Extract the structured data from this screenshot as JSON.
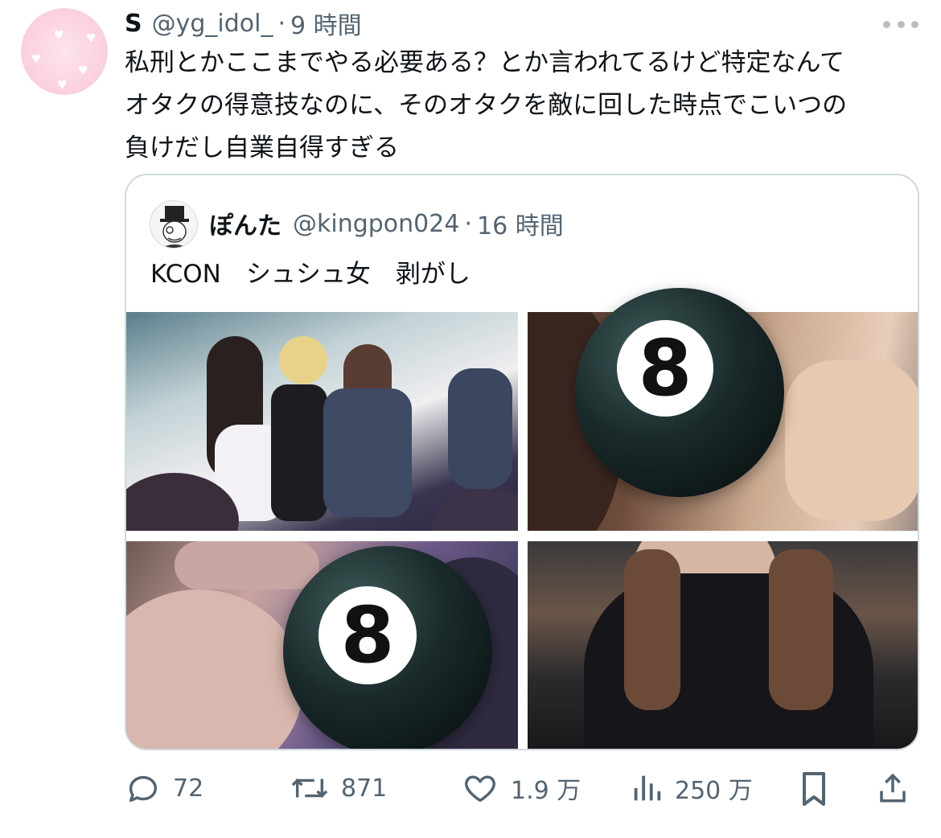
{
  "tweet": {
    "author_name": "S",
    "author_handle": "@yg_idol_",
    "separator": "·",
    "time": "9 時間",
    "text_lines": [
      "私刑とかここまでやる必要ある？とか言われてるけど特定なんて",
      "オタクの得意技なのに、そのオタクを敵に回した時点でこいつの",
      "負けだし自業自得すぎる"
    ]
  },
  "quote": {
    "author_name": "ぽんた",
    "author_handle": "@kingpon024",
    "separator": "·",
    "time": "16 時間",
    "text": "KCON　シュシュ女　剥がし",
    "media": [
      {
        "name": "stage-photo"
      },
      {
        "name": "face-photo-1",
        "overlay": "8"
      },
      {
        "name": "face-photo-2",
        "overlay": "8"
      },
      {
        "name": "staff-photo"
      }
    ]
  },
  "actions": {
    "replies": "72",
    "retweets": "871",
    "likes": "1.9 万",
    "views": "250 万"
  },
  "icons": {
    "reply": "reply-icon",
    "retweet": "retweet-icon",
    "like": "heart-icon",
    "views": "views-icon",
    "bookmark": "bookmark-icon",
    "share": "share-icon",
    "more": "more-icon"
  },
  "colors": {
    "text": "#0f1419",
    "secondary": "#536471",
    "border": "#cfd9de"
  }
}
